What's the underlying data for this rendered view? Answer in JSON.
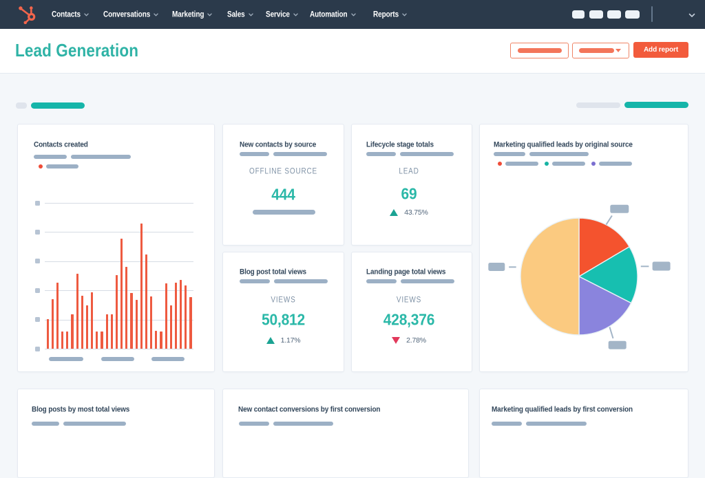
{
  "nav": {
    "logo": "hubspot-sprocket",
    "items": [
      {
        "label": "Contacts"
      },
      {
        "label": "Conversations"
      },
      {
        "label": "Marketing"
      },
      {
        "label": "Sales"
      },
      {
        "label": "Service"
      },
      {
        "label": "Automation"
      },
      {
        "label": "Reports"
      }
    ]
  },
  "header": {
    "title": "Lead Generation",
    "add_report_label": "Add report"
  },
  "cards": {
    "contacts_created": {
      "title": "Contacts created"
    },
    "new_contacts_by_source": {
      "title": "New contacts by source",
      "label": "OFFLINE SOURCE",
      "value": "444"
    },
    "lifecycle_stage_totals": {
      "title": "Lifecycle stage totals",
      "label": "LEAD",
      "value": "69",
      "delta": "43.75%",
      "delta_direction": "up"
    },
    "blog_post_total_views": {
      "title": "Blog post total views",
      "label": "VIEWS",
      "value": "50,812",
      "delta": "1.17%",
      "delta_direction": "up"
    },
    "landing_page_total_views": {
      "title": "Landing page total views",
      "label": "VIEWS",
      "value": "428,376",
      "delta": "2.78%",
      "delta_direction": "down"
    },
    "mql_by_original_source": {
      "title": "Marketing qualified leads by original source"
    },
    "blog_posts_by_most_total_views": {
      "title": "Blog posts by most total views"
    },
    "new_contact_conversions_by_first_conversion": {
      "title": "New contact conversions by first conversion"
    },
    "mql_by_first_conversion": {
      "title": "Marketing qualified leads by first conversion"
    }
  },
  "chart_data": [
    {
      "type": "bar",
      "title": "Contacts created",
      "xlabel": "",
      "ylabel": "",
      "values": [
        43,
        72,
        96,
        25,
        25,
        50,
        109,
        77,
        63,
        82,
        25,
        25,
        50,
        50,
        107,
        160,
        119,
        81,
        71,
        182,
        137,
        76,
        26,
        25,
        95,
        63,
        96,
        100,
        92,
        75
      ],
      "ylim": [
        0,
        212
      ],
      "gridlines": 6,
      "bar_color": "#ee5a40"
    },
    {
      "type": "pie",
      "title": "Marketing qualified leads by original source",
      "values": [
        16.5,
        16.0,
        17.5,
        50
      ],
      "colors": [
        "#f4532e",
        "#17bfb0",
        "#8a84dd",
        "#fbca80"
      ],
      "legend_dot_colors": [
        "#ef4c38",
        "#17b3a3",
        "#7b6fd0"
      ]
    }
  ],
  "colors": {
    "nav_bg": "#2b3a4b",
    "accent_orange": "#f25b3c",
    "teal_heading": "#2fb3a6",
    "teal_value": "#2bb8a8",
    "teal_bar": "#16b5a9",
    "steel_placeholder": "#9cb0c5",
    "delta_up": "#1ba393",
    "delta_down": "#e2395b"
  }
}
